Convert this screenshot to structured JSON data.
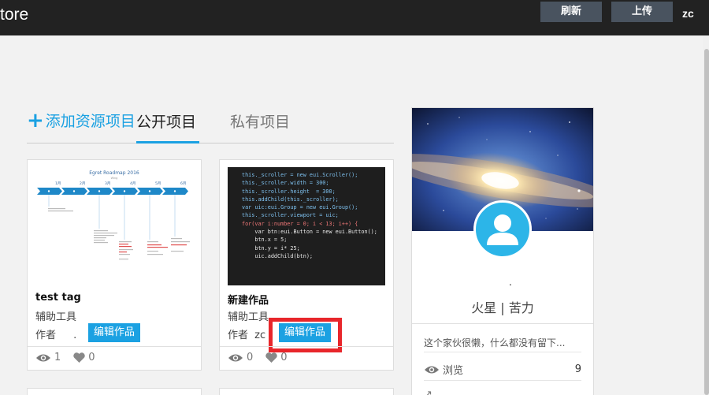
{
  "topbar": {
    "brand": "tore",
    "refresh_label": "刷新",
    "upload_label": "上传",
    "username": "zc"
  },
  "tabs": {
    "add_resource": "添加资源项目",
    "public": "公开项目",
    "private": "私有项目"
  },
  "cards": [
    {
      "title": "test tag",
      "category": "辅助工具",
      "author_label": "作者",
      "author_name": ".",
      "edit_label": "编辑作品",
      "views": "1",
      "likes": "0",
      "thumbnail": {
        "title": "Egret Roadmap 2016",
        "subtitle": "Wing",
        "months": [
          "1月",
          "2月",
          "3月",
          "4月",
          "5月",
          "6月"
        ]
      }
    },
    {
      "title": "新建作品",
      "category": "辅助工具",
      "author_label": "作者",
      "author_name": "zc",
      "edit_label": "编辑作品",
      "views": "0",
      "likes": "0",
      "thumbnail": {
        "code_lines": [
          "this._scroller = new eui.Scroller();",
          "this._scroller.width = 300;",
          "this._scroller.height  = 300;",
          "this.addChild(this._scroller);",
          "",
          "var uic:eui.Group = new eui.Group();",
          "",
          "this._scroller.viewport = uic;",
          "",
          "for(var i:number = 0; i < 13; i++) {",
          "    var btn:eui.Button = new eui.Button();",
          "    btn.x = 5;",
          "    btn.y = i* 25;",
          "    uic.addChild(btn);"
        ]
      }
    }
  ],
  "profile": {
    "dot": ".",
    "name": "火星 | 苦力",
    "bio": "这个家伙很懒，什么都没有留下...",
    "views_label": "浏览",
    "views_count": "9"
  },
  "colors": {
    "accent": "#1ba1e2",
    "topbar": "#222222",
    "highlight": "#e8262b",
    "avatar": "#2cb5e8"
  }
}
